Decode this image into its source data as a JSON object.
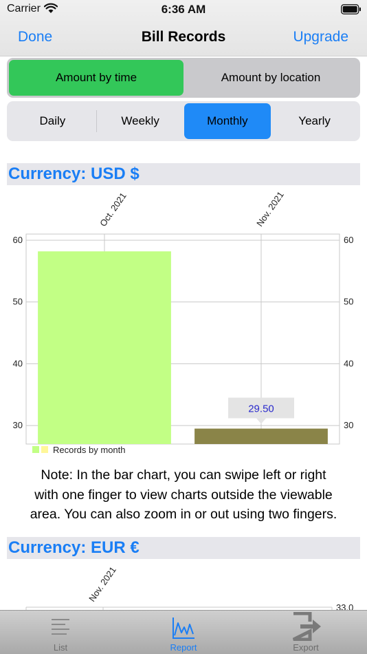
{
  "status": {
    "carrier": "Carrier",
    "time": "6:36 AM"
  },
  "nav": {
    "done": "Done",
    "title": "Bill Records",
    "upgrade": "Upgrade"
  },
  "amount_tabs": [
    {
      "label": "Amount by time",
      "active": true
    },
    {
      "label": "Amount by location",
      "active": false
    }
  ],
  "period_tabs": [
    {
      "label": "Daily",
      "active": false
    },
    {
      "label": "Weekly",
      "active": false
    },
    {
      "label": "Monthly",
      "active": true
    },
    {
      "label": "Yearly",
      "active": false
    }
  ],
  "sections": [
    {
      "currency_label": "Currency: USD $"
    },
    {
      "currency_label": "Currency: EUR €"
    }
  ],
  "chart_data": [
    {
      "type": "bar",
      "categories": [
        "Oct. 2021",
        "Nov. 2021"
      ],
      "values": [
        58.2,
        29.5
      ],
      "colors": [
        "#c2ff85",
        "#8a8448"
      ],
      "ylim": [
        27,
        61
      ],
      "y_ticks": [
        30,
        40,
        50,
        60
      ],
      "tooltip": {
        "category": "Nov. 2021",
        "text": "29.50"
      },
      "legend": {
        "label": "Records by month",
        "swatches": [
          "#c2ff85",
          "#fff799"
        ],
        "placement": "bottom-left"
      },
      "grid": true
    },
    {
      "type": "bar",
      "categories": [
        "Nov. 2021"
      ],
      "values": [
        33.0
      ],
      "y_ticks_right": [
        "33.0"
      ],
      "grid": true
    }
  ],
  "note": {
    "lines": [
      "Note: In the bar chart, you can swipe left or right",
      "with one finger to view charts outside the viewable",
      "area. You can also  zoom in or out using two fingers."
    ]
  },
  "tabbar": [
    {
      "label": "List",
      "icon": "list-icon",
      "active": false
    },
    {
      "label": "Report",
      "icon": "report-chart-icon",
      "active": true
    },
    {
      "label": "Export",
      "icon": "export-icon",
      "active": false
    }
  ],
  "accent": "#1a7ef5"
}
